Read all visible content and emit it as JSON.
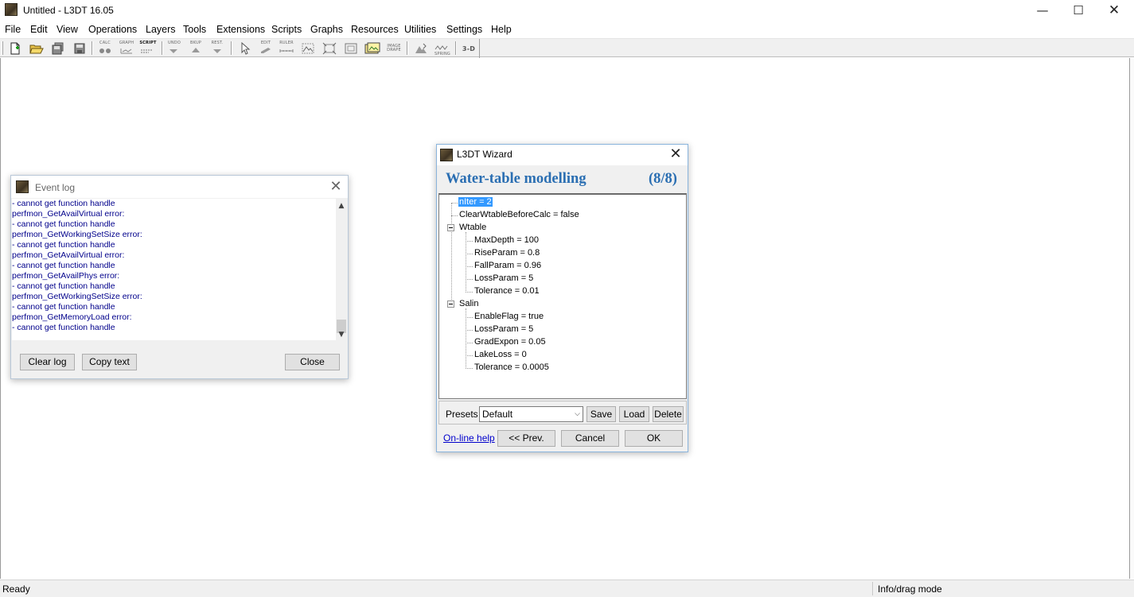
{
  "window": {
    "title": "Untitled - L3DT 16.05",
    "controls": {
      "minimize": "—",
      "maximize": "☐",
      "close": "✕"
    }
  },
  "menu": [
    "File",
    "Edit",
    "View",
    "Operations",
    "Layers",
    "Tools",
    "Extensions",
    "Scripts",
    "Graphs",
    "Resources",
    "Utilities",
    "Settings",
    "Help"
  ],
  "toolbar": {
    "calc": "CALC",
    "graph": "GRAPH",
    "script": "SCRIPT",
    "undo": "UNDO",
    "bkup": "BKUP",
    "rest": "REST.",
    "edit": "EDIT",
    "ruler": "RULER",
    "image_drape": "IMAGE DRAPE",
    "spring": "SPRING",
    "three_d": "3-D"
  },
  "status": {
    "left": "Ready",
    "right": "Info/drag mode"
  },
  "event_log": {
    "title": "Event log",
    "lines": [
      " - cannot get function handle",
      "perfmon_GetAvailVirtual error:",
      " - cannot get function handle",
      "perfmon_GetWorkingSetSize error:",
      " - cannot get function handle",
      "perfmon_GetAvailVirtual error:",
      " - cannot get function handle",
      "perfmon_GetAvailPhys error:",
      " - cannot get function handle",
      "perfmon_GetWorkingSetSize error:",
      " - cannot get function handle",
      "perfmon_GetMemoryLoad error:",
      " - cannot get function handle"
    ],
    "buttons": {
      "clear": "Clear log",
      "copy": "Copy text",
      "close": "Close"
    }
  },
  "wizard": {
    "title": "L3DT Wizard",
    "heading": "Water-table modelling",
    "step": "(8/8)",
    "tree": {
      "niter": "nIter = 2",
      "clear": "ClearWtableBeforeCalc = false",
      "wtable": "Wtable",
      "wtable_children": [
        "MaxDepth = 100",
        "RiseParam = 0.8",
        "FallParam = 0.96",
        "LossParam = 5",
        "Tolerance = 0.01"
      ],
      "salin": "Salin",
      "salin_children": [
        "EnableFlag = true",
        "LossParam = 5",
        "GradExpon = 0.05",
        "LakeLoss = 0",
        "Tolerance = 0.0005"
      ]
    },
    "presets": {
      "label": "Presets",
      "selected": "Default",
      "save": "Save",
      "load": "Load",
      "delete": "Delete"
    },
    "online_help": "On-line help",
    "buttons": {
      "prev": "<< Prev.",
      "cancel": "Cancel",
      "ok": "OK"
    }
  }
}
